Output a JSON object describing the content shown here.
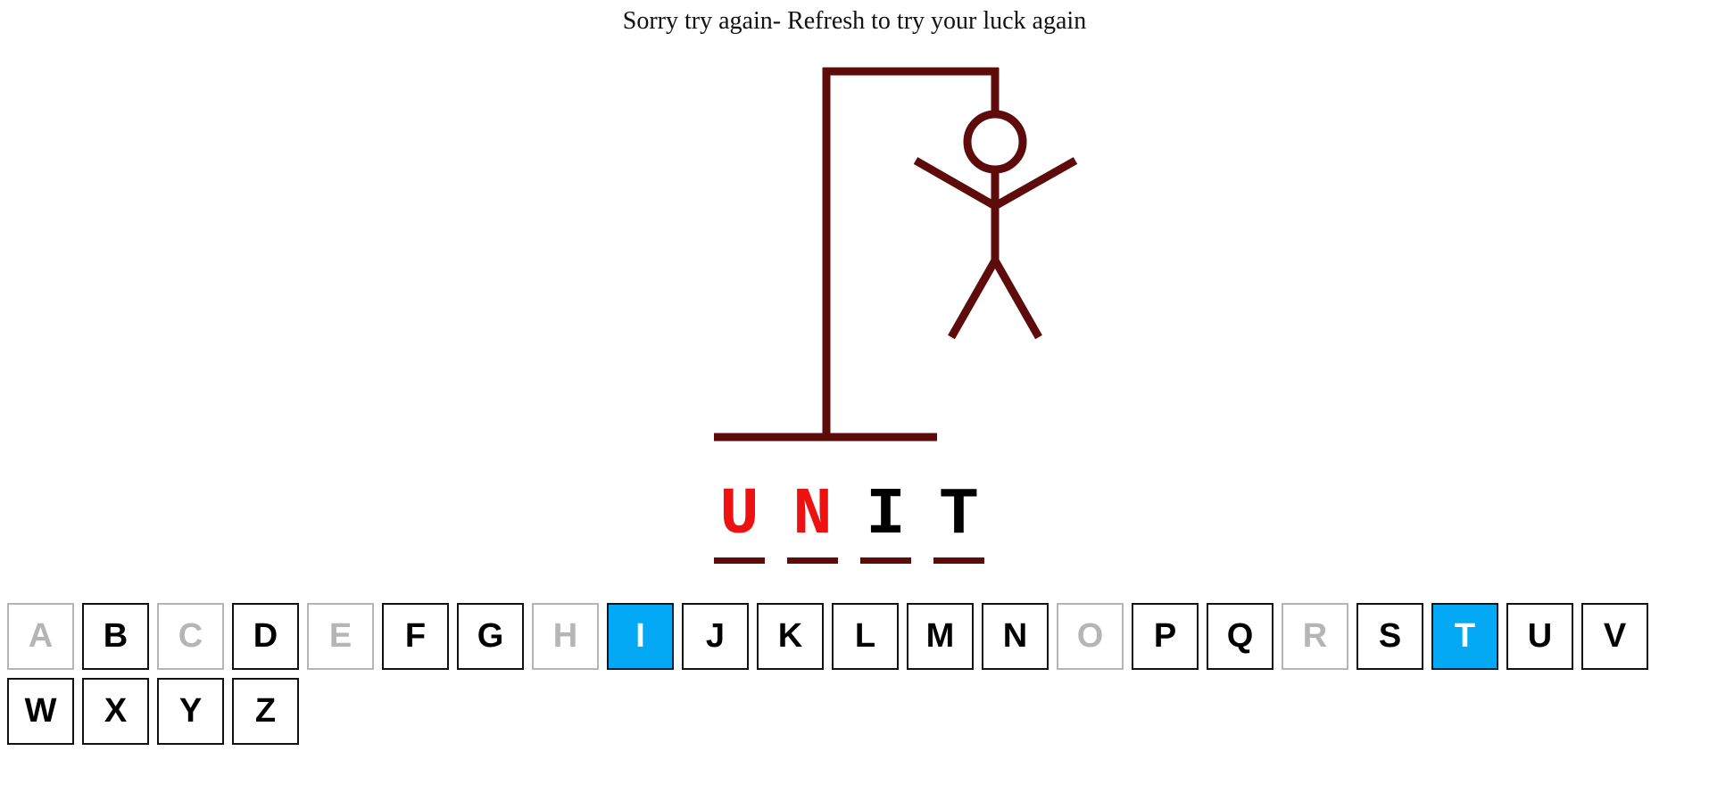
{
  "status": {
    "message": "Sorry try again- Refresh to try your luck again"
  },
  "colors": {
    "gallows": "#5e0b0b",
    "missed_letter": "#ee1111",
    "revealed_letter": "#000000",
    "correct_key_bg": "#03a9f4",
    "used_key": "#b5b5b5"
  },
  "hangman": {
    "parts_drawn": [
      "base",
      "pole",
      "beam",
      "rope",
      "head",
      "body",
      "left-arm",
      "right-arm",
      "left-leg",
      "right-leg"
    ]
  },
  "word": {
    "letters": [
      {
        "char": "U",
        "state": "missed"
      },
      {
        "char": "N",
        "state": "missed"
      },
      {
        "char": "I",
        "state": "guessed"
      },
      {
        "char": "T",
        "state": "guessed"
      }
    ]
  },
  "keyboard": {
    "keys": [
      {
        "letter": "A",
        "state": "used"
      },
      {
        "letter": "B",
        "state": "available"
      },
      {
        "letter": "C",
        "state": "used"
      },
      {
        "letter": "D",
        "state": "available"
      },
      {
        "letter": "E",
        "state": "used"
      },
      {
        "letter": "F",
        "state": "available"
      },
      {
        "letter": "G",
        "state": "available"
      },
      {
        "letter": "H",
        "state": "used"
      },
      {
        "letter": "I",
        "state": "correct"
      },
      {
        "letter": "J",
        "state": "available"
      },
      {
        "letter": "K",
        "state": "available"
      },
      {
        "letter": "L",
        "state": "available"
      },
      {
        "letter": "M",
        "state": "available"
      },
      {
        "letter": "N",
        "state": "available"
      },
      {
        "letter": "O",
        "state": "used"
      },
      {
        "letter": "P",
        "state": "available"
      },
      {
        "letter": "Q",
        "state": "available"
      },
      {
        "letter": "R",
        "state": "used"
      },
      {
        "letter": "S",
        "state": "available"
      },
      {
        "letter": "T",
        "state": "correct"
      },
      {
        "letter": "U",
        "state": "available"
      },
      {
        "letter": "V",
        "state": "available"
      },
      {
        "letter": "W",
        "state": "available"
      },
      {
        "letter": "X",
        "state": "available"
      },
      {
        "letter": "Y",
        "state": "available"
      },
      {
        "letter": "Z",
        "state": "available"
      }
    ]
  }
}
